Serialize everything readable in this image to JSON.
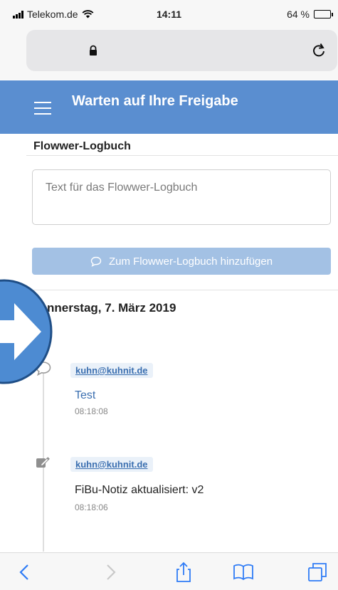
{
  "status_bar": {
    "carrier": "Telekom.de",
    "time": "14:11",
    "battery": "64 %",
    "battery_level": 0.64
  },
  "browser": {
    "lock_icon": "lock-icon",
    "reload_icon": "reload-icon"
  },
  "header": {
    "title": "Warten auf Ihre Freigabe",
    "menu_icon": "hamburger-menu-icon",
    "color": "#5a8ed0"
  },
  "logbook": {
    "title": "Flowwer-Logbuch",
    "input_placeholder": "Text für das Flowwer-Logbuch",
    "add_button_label": "Zum Flowwer-Logbuch hinzufügen"
  },
  "timeline": {
    "date_heading": "nnerstag, 7. März 2019",
    "entries": [
      {
        "icon": "comment-icon",
        "user": "kuhn@kuhnit.de",
        "text": "Test",
        "time": "08:18:08"
      },
      {
        "icon": "edit-icon",
        "user": "kuhn@kuhnit.de",
        "text": "FiBu-Notiz aktualisiert: v2",
        "time": "08:18:06"
      }
    ]
  },
  "bottom_nav": [
    "back-icon",
    "forward-icon",
    "share-icon",
    "bookmarks-icon",
    "tabs-icon"
  ]
}
